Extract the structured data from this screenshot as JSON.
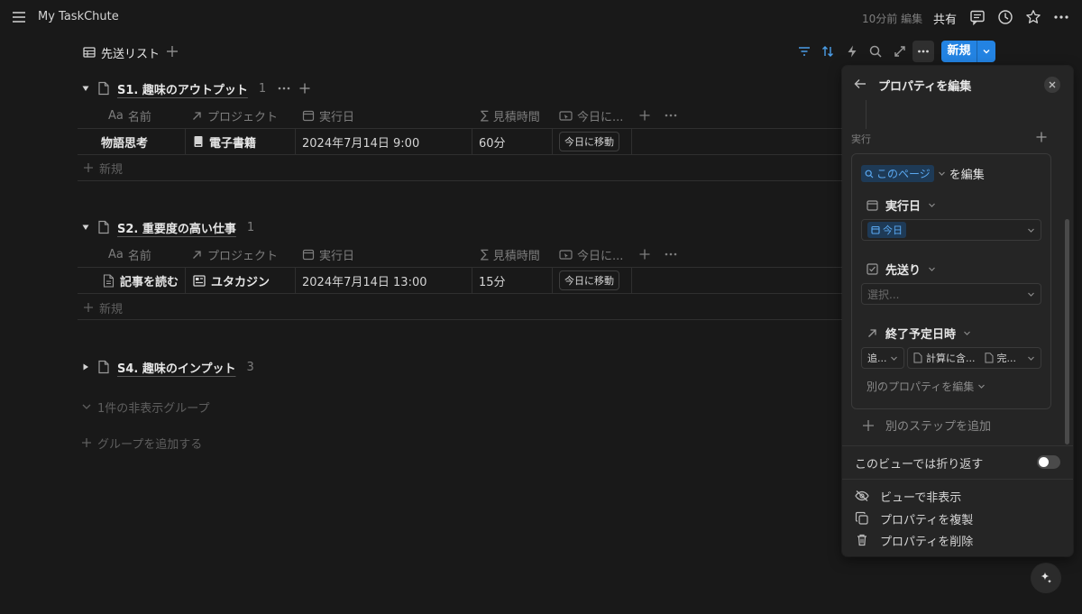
{
  "topbar": {
    "app_title": "My TaskChute",
    "edited": "10分前 編集",
    "share": "共有",
    "icons": [
      "menu-icon",
      "comment-icon",
      "clock-icon",
      "star-icon",
      "more-icon"
    ]
  },
  "view": {
    "tab_label": "先送リスト",
    "new_label": "新規"
  },
  "columns": {
    "name": "名前",
    "project": "プロジェクト",
    "date": "実行日",
    "estimate": "見積時間",
    "today": "今日に..."
  },
  "column_prefix": {
    "name": "Aa",
    "estimate": "∑"
  },
  "groups": [
    {
      "title": "S1. 趣味のアウトプット",
      "count": "1",
      "rows": [
        {
          "name": "物語思考",
          "project": "電子書籍",
          "date": "2024年7月14日 9:00",
          "estimate": "60分",
          "button": "今日に移動"
        }
      ]
    },
    {
      "title": "S2. 重要度の高い仕事",
      "count": "1",
      "rows": [
        {
          "name": "記事を読む",
          "project": "ユタカジン",
          "date": "2024年7月14日 13:00",
          "estimate": "15分",
          "button": "今日に移動"
        }
      ]
    },
    {
      "title": "S4. 趣味のインプット",
      "count": "3",
      "rows": []
    }
  ],
  "new_row_label": "新規",
  "hidden_groups": "1件の非表示グループ",
  "add_group": "グループを追加する",
  "panel": {
    "title": "プロパティを編集",
    "section_label": "実行",
    "this_page": "このページ",
    "edit_suffix": "を編集",
    "field1": "実行日",
    "field1_value": "今日",
    "field2": "先送り",
    "field2_placeholder": "選択...",
    "field3": "終了予定日時",
    "field3_op": "追...",
    "field3_a": "計算に含...",
    "field3_b": "完...",
    "other_property": "別のプロパティを編集",
    "add_step": "別のステップを追加",
    "wrap_label": "このビューでは折り返す",
    "wrap_on": false,
    "hide_view": "ビューで非表示",
    "duplicate": "プロパティを複製",
    "delete": "プロパティを削除"
  },
  "colors": {
    "accent": "#2383e2",
    "background": "#191919",
    "panel": "#252525"
  }
}
